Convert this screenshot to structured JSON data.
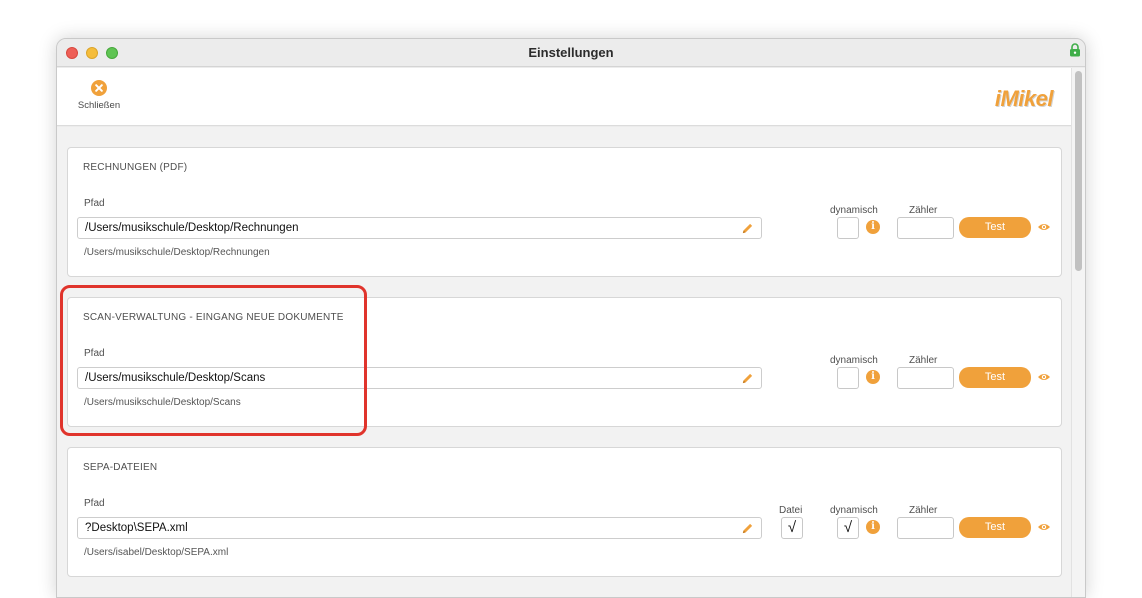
{
  "window": {
    "title": "Einstellungen"
  },
  "toolbar": {
    "close_label": "Schließen",
    "logo_text": "iMikel"
  },
  "colors": {
    "accent": "#f0a13b",
    "highlight": "#e0342c"
  },
  "sections": [
    {
      "title": "RECHNUNGEN (PDF)",
      "path_label": "Pfad",
      "path_value": "/Users/musikschule/Desktop/Rechnungen",
      "resolved_path": "/Users/musikschule/Desktop/Rechnungen",
      "dynamisch_label": "dynamisch",
      "dynamisch_checked": "",
      "zaehler_label": "Zähler",
      "test_label": "Test"
    },
    {
      "title": "SCAN-VERWALTUNG - EINGANG NEUE DOKUMENTE",
      "path_label": "Pfad",
      "path_value": "/Users/musikschule/Desktop/Scans",
      "resolved_path": "/Users/musikschule/Desktop/Scans",
      "dynamisch_label": "dynamisch",
      "dynamisch_checked": "",
      "zaehler_label": "Zähler",
      "test_label": "Test"
    },
    {
      "title": "SEPA-DATEIEN",
      "path_label": "Pfad",
      "path_value": "?Desktop\\SEPA.xml",
      "resolved_path": "/Users/isabel/Desktop/SEPA.xml",
      "datei_label": "Datei",
      "datei_checked": "√",
      "dynamisch_label": "dynamisch",
      "dynamisch_checked": "√",
      "zaehler_label": "Zähler",
      "test_label": "Test"
    }
  ]
}
